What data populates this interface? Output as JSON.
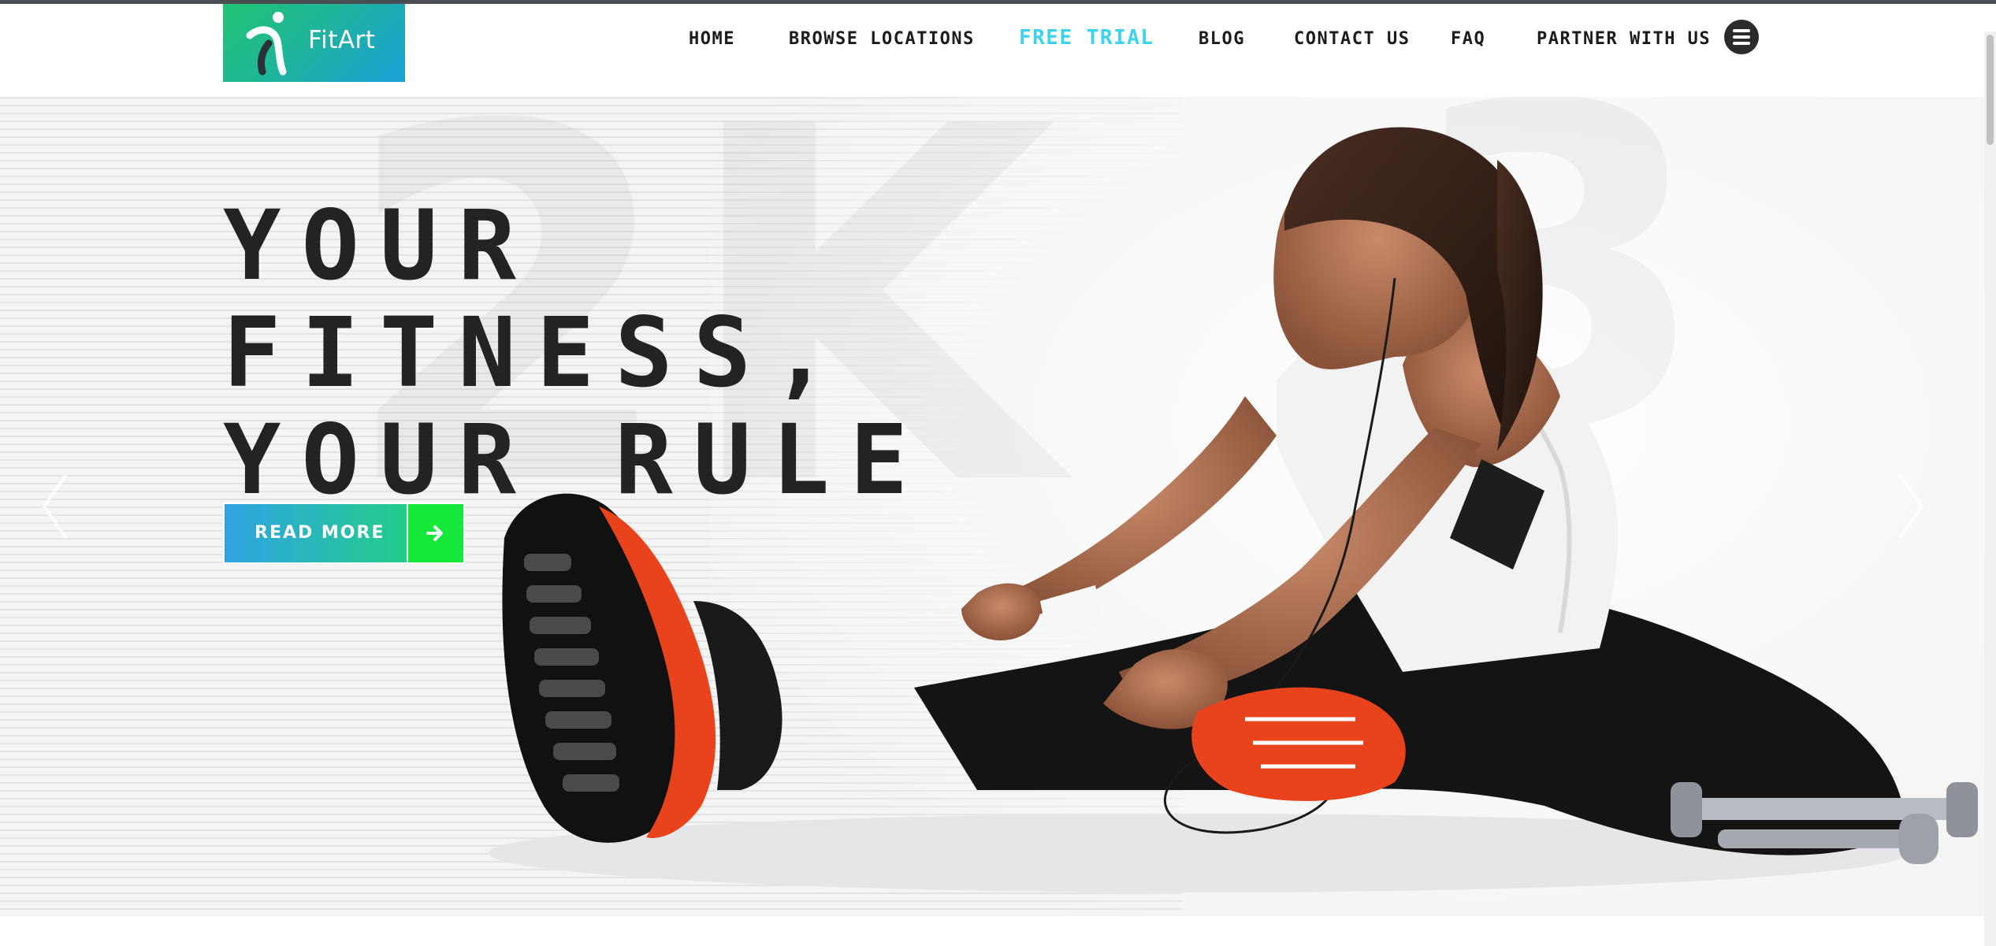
{
  "brand": {
    "name": "FitArt",
    "icon": "runner-logo-icon",
    "gradient": [
      "#22c373",
      "#1c9fd8"
    ]
  },
  "nav": {
    "items": [
      {
        "label": "HOME",
        "active": false
      },
      {
        "label": "BROWSE LOCATIONS",
        "active": false
      },
      {
        "label": "FREE TRIAL",
        "active": true
      },
      {
        "label": "BLOG",
        "active": false
      },
      {
        "label": "CONTACT US",
        "active": false
      },
      {
        "label": "FAQ",
        "active": false
      },
      {
        "label": "PARTNER WITH US",
        "active": false
      }
    ],
    "menu_icon": "hamburger-icon",
    "active_color": "#3fd2f0"
  },
  "hero": {
    "title_lines": [
      "YOUR",
      "FITNESS,",
      "YOUR RULE"
    ],
    "cta_label": "READ MORE",
    "cta_icon": "arrow-right-icon",
    "prev_icon": "chevron-left-icon",
    "next_icon": "chevron-right-icon",
    "background_numerals": [
      "2K",
      "3"
    ],
    "colors": {
      "title": "#232326",
      "cta_start": "#2ea3e3",
      "cta_end": "#24cd8a",
      "cta_arrow_bg": "#15e83a"
    }
  }
}
